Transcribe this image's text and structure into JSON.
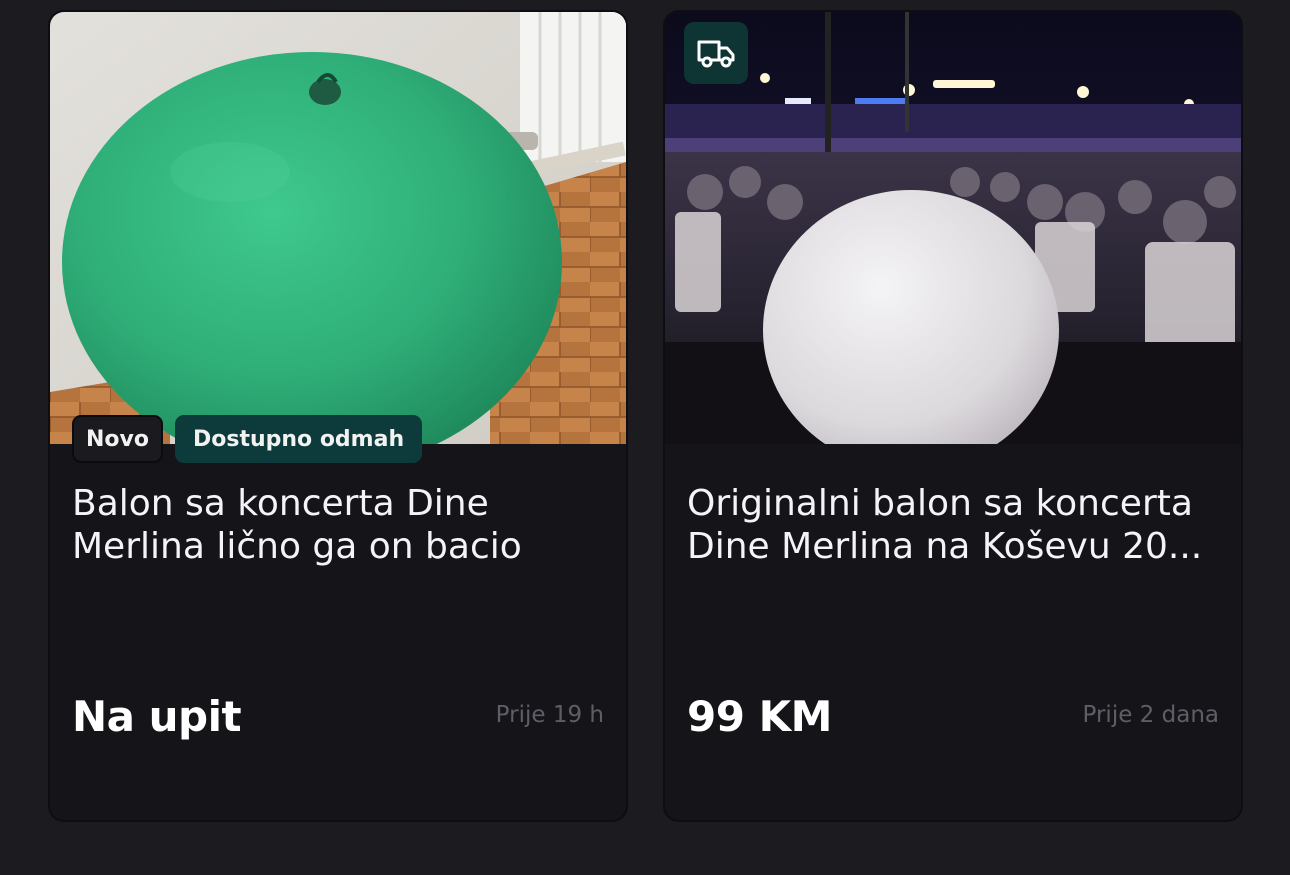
{
  "listings": [
    {
      "image_description": "green-balloon",
      "badges": {
        "condition": "Novo",
        "availability": "Dostupno odmah"
      },
      "title": "Balon sa koncerta Dine Merlina lično ga on bacio",
      "price": "Na upit",
      "posted": "Prije 19 h",
      "delivery": false
    },
    {
      "image_description": "white-balloon-concert",
      "title": "Originalni balon sa koncerta Dine Merlina na Koševu 20...",
      "price": "99 KM",
      "posted": "Prije 2 dana",
      "delivery": true,
      "delivery_icon": "truck-icon"
    }
  ],
  "colors": {
    "page_bg": "#1b1b20",
    "card_bg": "#141419",
    "accent_badge": "#0d3a3a",
    "muted_text": "#5e5e66"
  }
}
